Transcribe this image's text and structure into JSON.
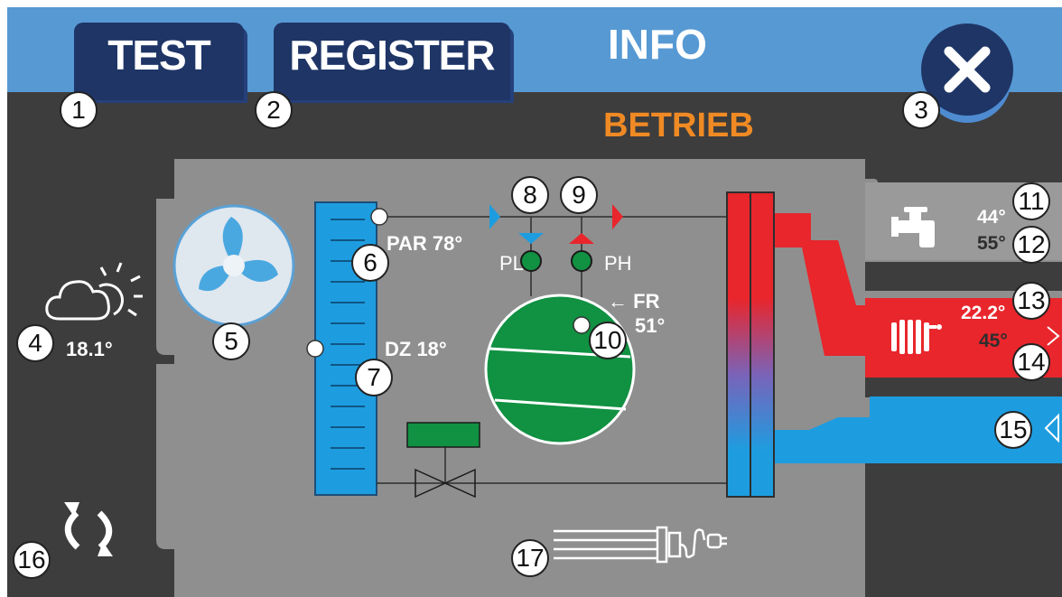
{
  "tabs": {
    "test_label": "TEST",
    "register_label": "REGISTER",
    "info_label": "INFO"
  },
  "status": "BETRIEB",
  "badges": [
    "1",
    "2",
    "3",
    "4",
    "5",
    "6",
    "7",
    "8",
    "9",
    "10",
    "11",
    "12",
    "13",
    "14",
    "15",
    "16"
  ],
  "badge17": "17",
  "outdoor": {
    "temperature": "18.1°",
    "icon": "cloud-sun-icon"
  },
  "sensors": {
    "par": "PAR 78°",
    "dz": "DZ 18°",
    "pl": "PL",
    "ph": "PH",
    "fr": "FR",
    "fr_value": "51°"
  },
  "hot_water": {
    "value1": "44°",
    "value2": "55°",
    "icon": "tap-icon"
  },
  "heating": {
    "value1": "22.2°",
    "value2": "45°",
    "icon": "radiator-icon"
  },
  "colors": {
    "accent_orange": "#f08a24",
    "hot": "#e8262c",
    "cold": "#1d9de0",
    "tab_dark": "#1e3566",
    "topbar": "#5799d3",
    "compressor": "#119142"
  }
}
